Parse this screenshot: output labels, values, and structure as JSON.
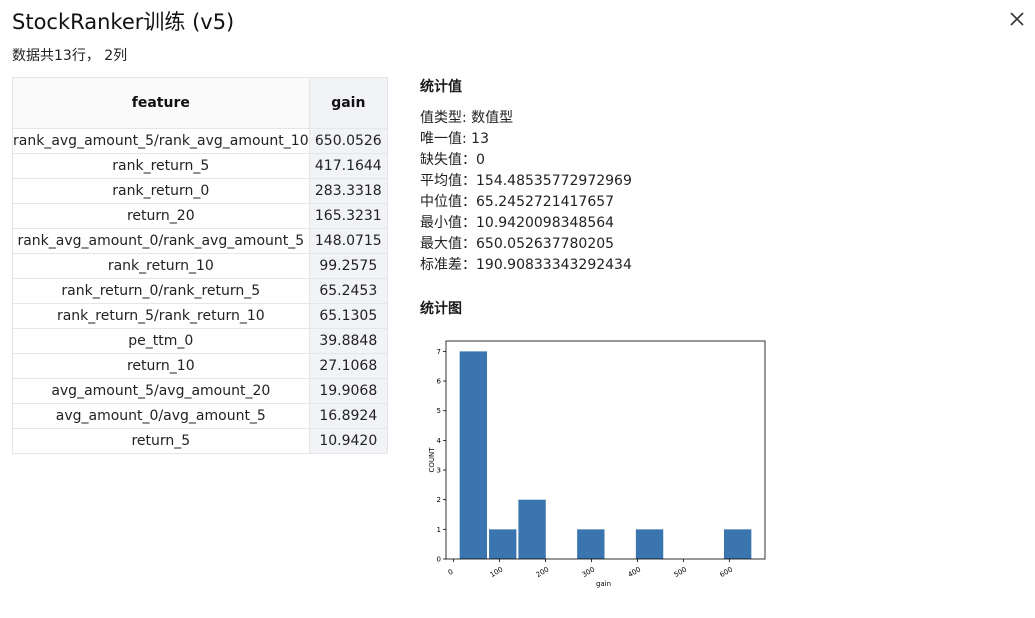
{
  "dialog": {
    "title": "StockRanker训练 (v5)",
    "close_icon": "close-icon",
    "summary": "数据共13行， 2列"
  },
  "table": {
    "headers": [
      "feature",
      "gain"
    ],
    "rows": [
      {
        "feature": "rank_avg_amount_5/rank_avg_amount_10",
        "gain": "650.0526"
      },
      {
        "feature": "rank_return_5",
        "gain": "417.1644"
      },
      {
        "feature": "rank_return_0",
        "gain": "283.3318"
      },
      {
        "feature": "return_20",
        "gain": "165.3231"
      },
      {
        "feature": "rank_avg_amount_0/rank_avg_amount_5",
        "gain": "148.0715"
      },
      {
        "feature": "rank_return_10",
        "gain": "99.2575"
      },
      {
        "feature": "rank_return_0/rank_return_5",
        "gain": "65.2453"
      },
      {
        "feature": "rank_return_5/rank_return_10",
        "gain": "65.1305"
      },
      {
        "feature": "pe_ttm_0",
        "gain": "39.8848"
      },
      {
        "feature": "return_10",
        "gain": "27.1068"
      },
      {
        "feature": "avg_amount_5/avg_amount_20",
        "gain": "19.9068"
      },
      {
        "feature": "avg_amount_0/avg_amount_5",
        "gain": "16.8924"
      },
      {
        "feature": "return_5",
        "gain": "10.9420"
      }
    ]
  },
  "stats": {
    "heading": "统计值",
    "lines": [
      "值类型: 数值型",
      "唯一值: 13",
      "缺失值：0",
      "平均值：154.48535772972969",
      "中位值：65.2452721417657",
      "最小值：10.9420098348564",
      "最大值：650.052637780205",
      "标准差：190.90833343292434"
    ]
  },
  "chart": {
    "heading": "统计图",
    "bar_color": "#3b75af"
  },
  "chart_data": {
    "type": "bar",
    "xlabel": "gain",
    "ylabel": "COUNT",
    "bins": [
      {
        "x0": 10.94,
        "x1": 74.85,
        "count": 7
      },
      {
        "x0": 74.85,
        "x1": 138.76,
        "count": 1
      },
      {
        "x0": 138.76,
        "x1": 202.67,
        "count": 2
      },
      {
        "x0": 202.67,
        "x1": 266.59,
        "count": 0
      },
      {
        "x0": 266.59,
        "x1": 330.5,
        "count": 1
      },
      {
        "x0": 330.5,
        "x1": 394.41,
        "count": 0
      },
      {
        "x0": 394.41,
        "x1": 458.32,
        "count": 1
      },
      {
        "x0": 458.32,
        "x1": 522.23,
        "count": 0
      },
      {
        "x0": 522.23,
        "x1": 586.14,
        "count": 0
      },
      {
        "x0": 586.14,
        "x1": 650.05,
        "count": 1
      }
    ],
    "xticks": [
      0,
      100,
      200,
      300,
      400,
      500,
      600
    ],
    "yticks": [
      0,
      1,
      2,
      3,
      4,
      5,
      6,
      7
    ],
    "xlim": [
      -16.61,
      677.61
    ],
    "ylim": [
      0,
      7.35
    ],
    "grid": false
  }
}
